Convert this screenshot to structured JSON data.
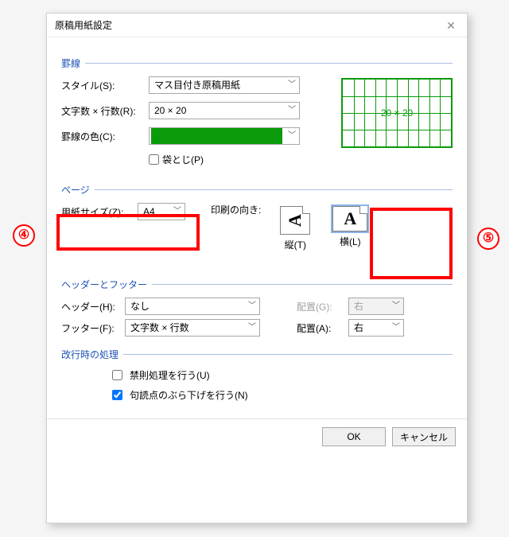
{
  "window": {
    "title": "原稿用紙設定"
  },
  "groups": {
    "grid": "罫線",
    "page": "ページ",
    "hf": "ヘッダーとフッター",
    "wrap": "改行時の処理"
  },
  "grid": {
    "style_label": "スタイル(S):",
    "style_value": "マス目付き原稿用紙",
    "rc_label": "文字数 × 行数(R):",
    "rc_value": "20 × 20",
    "color_label": "罫線の色(C):",
    "color_value": "#0a9b0a",
    "fold_label": "袋とじ(P)",
    "preview_text": "20 × 20"
  },
  "page": {
    "size_label": "用紙サイズ(Z):",
    "size_value": "A4",
    "orient_label": "印刷の向き:",
    "portrait_label": "縦(T)",
    "landscape_label": "横(L)",
    "selected": "landscape"
  },
  "hf": {
    "header_label": "ヘッダー(H):",
    "header_value": "なし",
    "footer_label": "フッター(F):",
    "footer_value": "文字数 × 行数",
    "align_label_g": "配置(G):",
    "align_value_g": "右",
    "align_label_a": "配置(A):",
    "align_value_a": "右"
  },
  "wrap": {
    "kinsoku_label": "禁則処理を行う(U)",
    "kinsoku_checked": false,
    "kutouten_label": "句読点のぶら下げを行う(N)",
    "kutouten_checked": true
  },
  "buttons": {
    "ok": "OK",
    "cancel": "キャンセル"
  },
  "markers": {
    "m4": "④",
    "m5": "⑤"
  }
}
